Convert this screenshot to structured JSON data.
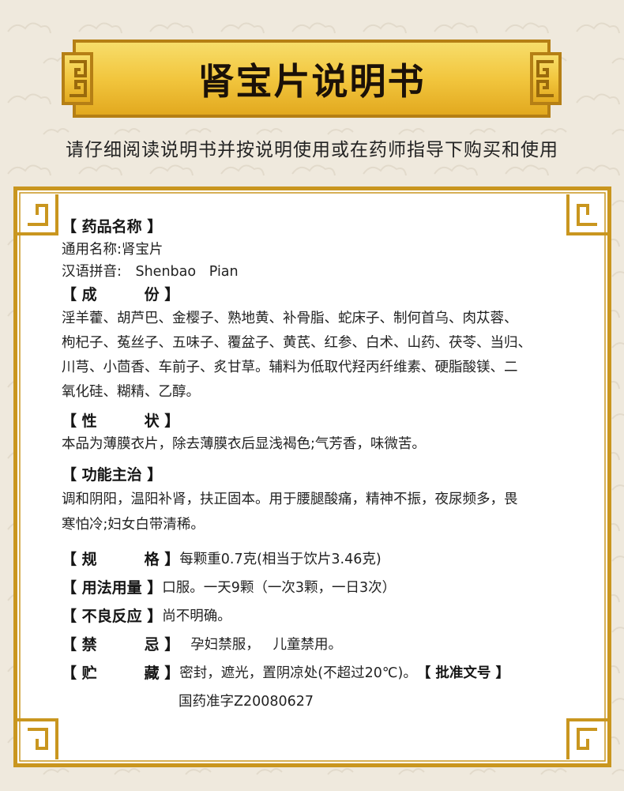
{
  "title": "肾宝片说明书",
  "subtitle": "请仔细阅读说明书并按说明使用或在药师指导下购买和使用",
  "colors": {
    "background": "#efe9dd",
    "gold_light": "#f3cf52",
    "gold_dark": "#b07c12",
    "frame_gold": "#c9961f",
    "paper": "#ffffff"
  },
  "sections": {
    "name": {
      "heading": "【 药品名称 】",
      "common_name": "通用名称:肾宝片",
      "pinyin_label": "汉语拼音:",
      "pinyin_value": "Shenbao   Pian"
    },
    "ingredients": {
      "heading_open": "【 ",
      "heading_a": "成",
      "heading_b": "份",
      "heading_close": " 】",
      "lines": [
        "淫羊藿、胡芦巴、金樱子、熟地黄、补骨脂、蛇床子、制何首乌、肉苁蓉、",
        "枸杞子、菟丝子、五味子、覆盆子、黄芪、红参、白术、山药、茯苓、当归、",
        "川芎、小茴香、车前子、炙甘草。辅料为低取代羟丙纤维素、硬脂酸镁、二",
        "氧化硅、糊精、乙醇。"
      ]
    },
    "character": {
      "heading_open": "【 ",
      "heading_a": "性",
      "heading_b": "状",
      "heading_close": " 】",
      "text": "本品为薄膜衣片，除去薄膜衣后显浅褐色;气芳香，味微苦。"
    },
    "indications": {
      "heading": "【 功能主治 】",
      "lines": [
        "调和阴阳，温阳补肾，扶正固本。用于腰腿酸痛，精神不振，夜尿频多，畏",
        "寒怕冷;妇女白带清稀。"
      ]
    },
    "spec": {
      "heading_open": "【 ",
      "heading_a": "规",
      "heading_b": "格",
      "heading_close": " 】",
      "text": "每颗重0.7克(相当于饮片3.46克)"
    },
    "dosage": {
      "heading": "【 用法用量 】",
      "text": "口服。一天9颗（一次3颗，一日3次）"
    },
    "adverse": {
      "heading": "【 不良反应 】",
      "text": "尚不明确。"
    },
    "contra": {
      "heading_open": "【 ",
      "heading_a": "禁",
      "heading_b": "忌",
      "heading_close": " 】",
      "text": "孕妇禁服，   儿童禁用。"
    },
    "storage": {
      "heading_open": "【 ",
      "heading_a": "贮",
      "heading_b": "藏",
      "heading_close": " 】",
      "text": "密封，遮光，置阴凉处(不超过20℃)。",
      "approval_heading": "【 批准文号 】",
      "approval_number": "国药准字Z20080627"
    }
  }
}
